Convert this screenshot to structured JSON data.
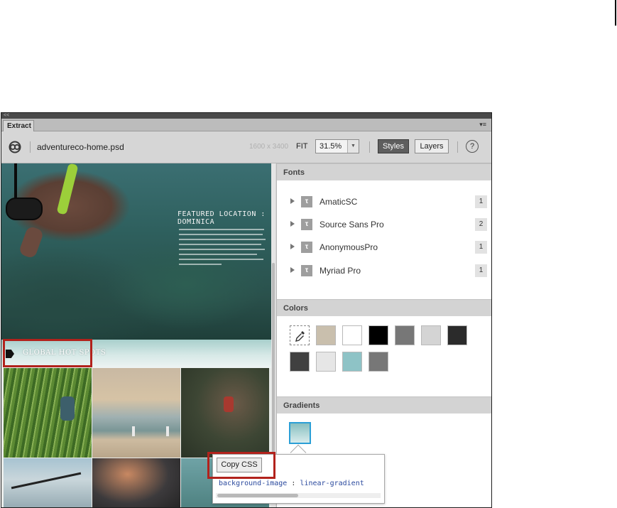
{
  "panel": {
    "tab_label": "Extract",
    "title_collapse": "<<"
  },
  "toolbar": {
    "filename": "adventureco-home.psd",
    "dimensions": "1600 x 3400",
    "fit_label": "FIT",
    "zoom": "31.5%",
    "styles_label": "Styles",
    "layers_label": "Layers",
    "help": "?"
  },
  "preview": {
    "featured_heading": "FEATURED LOCATION : DOMINICA",
    "global_heading": "GLOBAL HOT SPOTS"
  },
  "fonts": {
    "header": "Fonts",
    "items": [
      {
        "name": "AmaticSC",
        "count": "1"
      },
      {
        "name": "Source Sans Pro",
        "count": "2"
      },
      {
        "name": "AnonymousPro",
        "count": "1"
      },
      {
        "name": "Myriad Pro",
        "count": "1"
      }
    ]
  },
  "colors": {
    "header": "Colors",
    "swatches": [
      "#c9bfad",
      "#ffffff",
      "#000000",
      "#777777",
      "#d4d4d4",
      "#2b2b2b",
      "#404040",
      "#e6e6e6",
      "#8ec3c6",
      "#777777"
    ]
  },
  "gradients": {
    "header": "Gradients",
    "css_property": "background-image",
    "css_sep": ":",
    "css_value": "linear-gradient",
    "copy_label": "Copy CSS"
  }
}
